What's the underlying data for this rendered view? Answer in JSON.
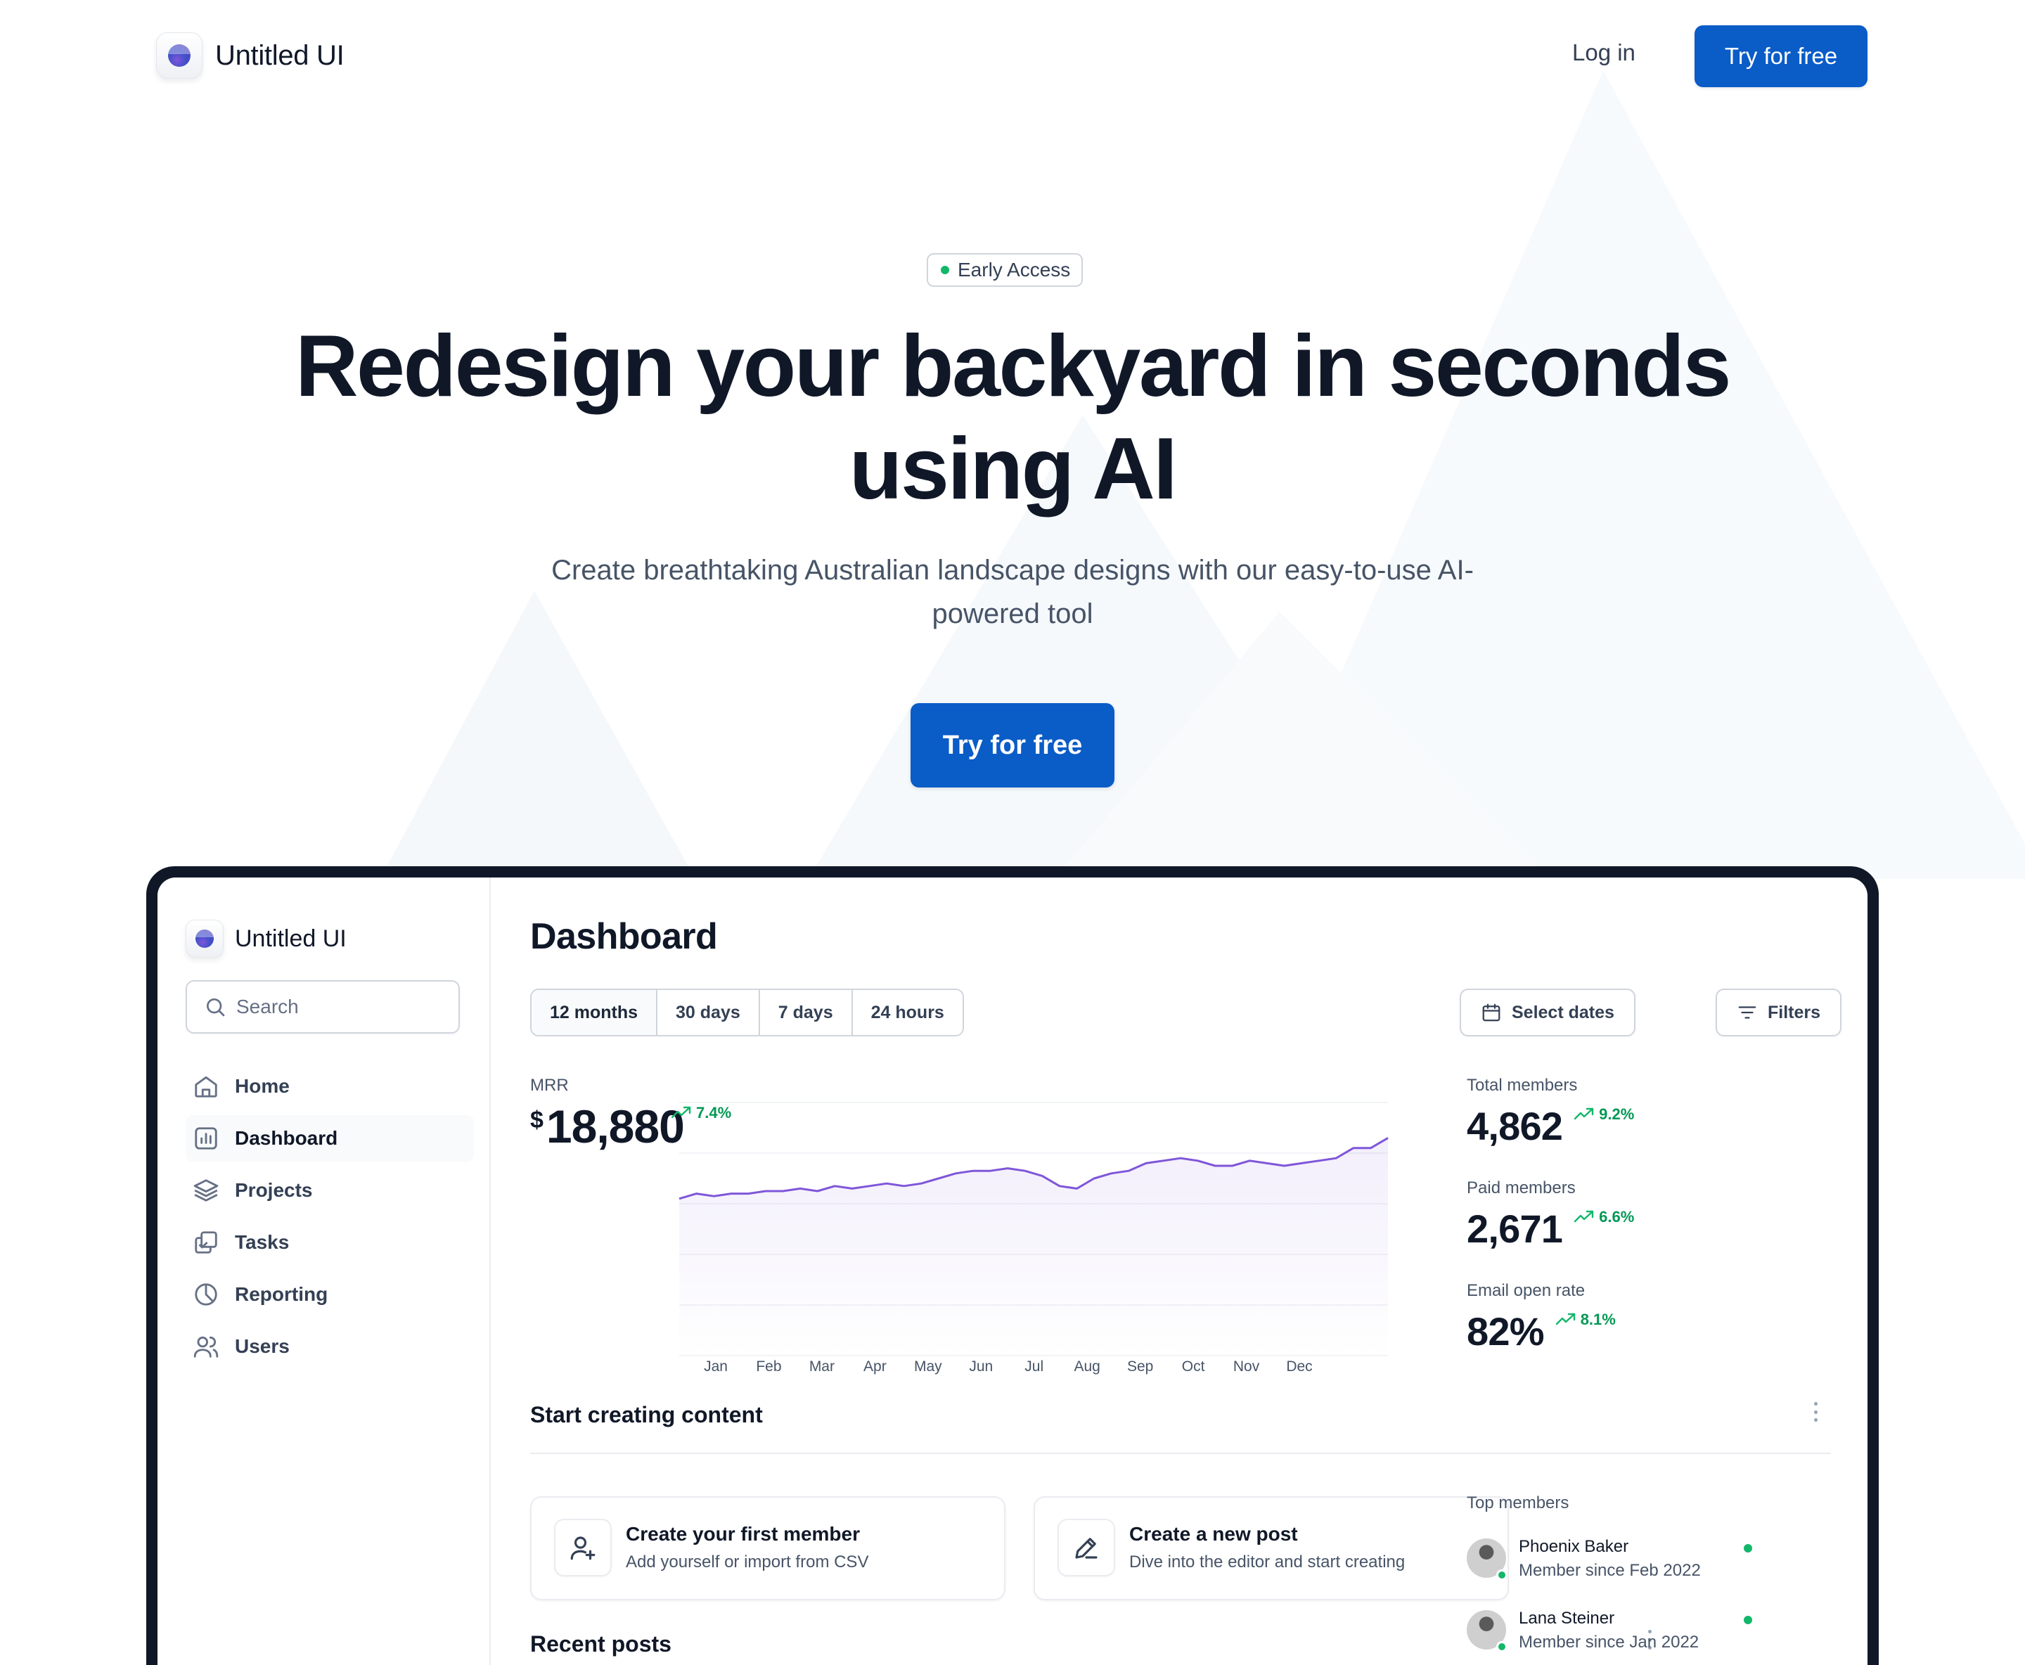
{
  "nav": {
    "brand": "Untitled UI",
    "login_label": "Log in",
    "try_label": "Try for free"
  },
  "hero": {
    "badge": "Early Access",
    "title_line1": "Redesign your backyard in seconds",
    "title_line2": "using AI",
    "subtitle_line1": "Create breathtaking Australian landscape designs with our easy-to-use AI-",
    "subtitle_line2": "powered tool",
    "cta_label": "Try for free"
  },
  "colors": {
    "primary": "#0a5cc7",
    "success": "#12b76a",
    "chart_line": "#7f56d9"
  },
  "dashboard": {
    "sidebar": {
      "brand": "Untitled UI",
      "search_placeholder": "Search",
      "items": [
        {
          "label": "Home",
          "icon": "home-icon"
        },
        {
          "label": "Dashboard",
          "icon": "bar-chart-icon"
        },
        {
          "label": "Projects",
          "icon": "layers-icon"
        },
        {
          "label": "Tasks",
          "icon": "check-square-icon"
        },
        {
          "label": "Reporting",
          "icon": "pie-chart-icon"
        },
        {
          "label": "Users",
          "icon": "users-icon"
        }
      ]
    },
    "title": "Dashboard",
    "ranges": [
      "12 months",
      "30 days",
      "7 days",
      "24 hours"
    ],
    "select_dates_label": "Select dates",
    "filters_label": "Filters",
    "mrr": {
      "label": "MRR",
      "currency": "$",
      "value": "18,880",
      "delta": "7.4%"
    },
    "stats": [
      {
        "label": "Total members",
        "value": "4,862",
        "delta": "9.2%"
      },
      {
        "label": "Paid members",
        "value": "2,671",
        "delta": "6.6%"
      },
      {
        "label": "Email open rate",
        "value": "82%",
        "delta": "8.1%"
      }
    ],
    "start_section_title": "Start creating content",
    "cards": [
      {
        "title": "Create your first member",
        "subtitle": "Add yourself or import from CSV",
        "icon": "user-plus-icon"
      },
      {
        "title": "Create a new post",
        "subtitle": "Dive into the editor and start creating",
        "icon": "pen-icon"
      }
    ],
    "recent_posts_title": "Recent posts",
    "top_members_label": "Top members",
    "members": [
      {
        "name": "Phoenix Baker",
        "since": "Member since Feb 2022"
      },
      {
        "name": "Lana Steiner",
        "since": "Member since Jan 2022"
      }
    ]
  },
  "chart_data": {
    "type": "area",
    "categories": [
      "Jan",
      "Feb",
      "Mar",
      "Apr",
      "May",
      "Jun",
      "Jul",
      "Aug",
      "Sep",
      "Oct",
      "Nov",
      "Dec"
    ],
    "series": [
      {
        "values": [
          62,
          64,
          63,
          64,
          64,
          65,
          65,
          66,
          65,
          67,
          66,
          67,
          68,
          67,
          68,
          70,
          72,
          73,
          73,
          74,
          73,
          71,
          67,
          66,
          70,
          72,
          73,
          76,
          77,
          78,
          77,
          75,
          75,
          77,
          76,
          75,
          76,
          77,
          78,
          82,
          82,
          86
        ]
      }
    ],
    "ylim": [
      0,
      100
    ],
    "grid": true,
    "legend": "none"
  }
}
